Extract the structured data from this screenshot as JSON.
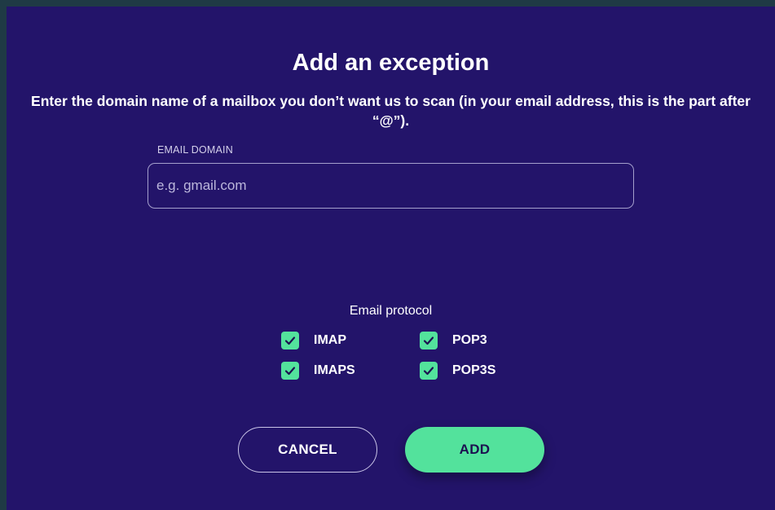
{
  "dialog": {
    "title": "Add an exception",
    "description": "Enter the domain name of a mailbox you don’t want us to scan (in your email address, this is the part after “@”).",
    "email_domain": {
      "label": "EMAIL DOMAIN",
      "value": "",
      "placeholder": "e.g. gmail.com"
    },
    "protocol": {
      "label": "Email protocol",
      "options": [
        {
          "label": "IMAP",
          "checked": true
        },
        {
          "label": "POP3",
          "checked": true
        },
        {
          "label": "IMAPS",
          "checked": true
        },
        {
          "label": "POP3S",
          "checked": true
        }
      ]
    },
    "buttons": {
      "cancel_label": "CANCEL",
      "add_label": "ADD"
    }
  },
  "colors": {
    "background": "#23146a",
    "accent": "#53e29c",
    "outer_frame": "#1f3a45"
  },
  "icons": {
    "checkbox": "check-icon"
  }
}
